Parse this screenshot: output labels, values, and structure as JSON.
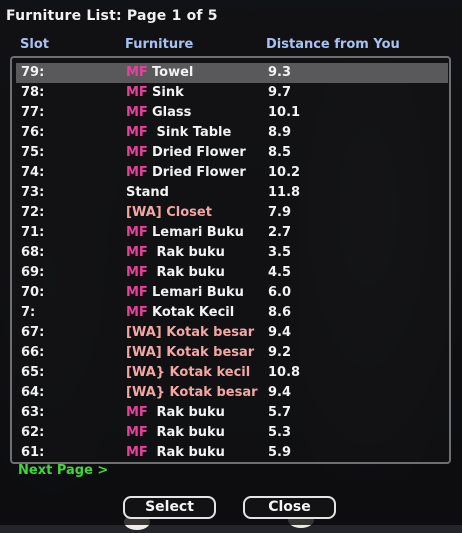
{
  "dialog": {
    "title": "Furniture List: Page 1 of 5",
    "columns": {
      "slot": "Slot",
      "furniture": "Furniture",
      "distance": "Distance from You"
    },
    "rows": [
      {
        "slot": "79:",
        "tag": "MF",
        "name": "Towel",
        "distance": "9.3",
        "selected": true
      },
      {
        "slot": "78:",
        "tag": "MF",
        "name": "Sink",
        "distance": "9.7"
      },
      {
        "slot": "77:",
        "tag": "MF",
        "name": "Glass",
        "distance": "10.1"
      },
      {
        "slot": "76:",
        "tag": "MF",
        "name": " Sink Table",
        "distance": "8.9"
      },
      {
        "slot": "75:",
        "tag": "MF",
        "name": "Dried Flower",
        "distance": "8.5"
      },
      {
        "slot": "74:",
        "tag": "MF",
        "name": "Dried Flower",
        "distance": "10.2"
      },
      {
        "slot": "73:",
        "tag": "",
        "name": "Stand",
        "distance": "11.8"
      },
      {
        "slot": "72:",
        "tag": "",
        "name": "[WA] Closet",
        "distance": "7.9",
        "wa": true
      },
      {
        "slot": "71:",
        "tag": "MF",
        "name": "Lemari Buku",
        "distance": "2.7"
      },
      {
        "slot": "68:",
        "tag": "MF",
        "name": " Rak buku",
        "distance": "3.5"
      },
      {
        "slot": "69:",
        "tag": "MF",
        "name": " Rak buku",
        "distance": "4.5"
      },
      {
        "slot": "70:",
        "tag": "MF",
        "name": "Lemari Buku",
        "distance": "6.0"
      },
      {
        "slot": "7:",
        "tag": "MF",
        "name": "Kotak Kecil",
        "distance": "8.6"
      },
      {
        "slot": "67:",
        "tag": "",
        "name": "[WA] Kotak besar",
        "distance": "9.4",
        "wa": true
      },
      {
        "slot": "66:",
        "tag": "",
        "name": "[WA] Kotak besar",
        "distance": "9.2",
        "wa": true
      },
      {
        "slot": "65:",
        "tag": "",
        "name": "[WA} Kotak kecil",
        "distance": "10.8",
        "wa": true
      },
      {
        "slot": "64:",
        "tag": "",
        "name": "[WA} Kotak besar",
        "distance": "9.4",
        "wa": true
      },
      {
        "slot": "63:",
        "tag": "MF",
        "name": " Rak buku",
        "distance": "5.7"
      },
      {
        "slot": "62:",
        "tag": "MF",
        "name": " Rak buku",
        "distance": "5.3"
      },
      {
        "slot": "61:",
        "tag": "MF",
        "name": " Rak buku",
        "distance": "5.9"
      }
    ],
    "next_page": "Next Page >",
    "buttons": {
      "select": "Select",
      "close": "Close"
    }
  },
  "colors": {
    "header": "#a9c1f2",
    "mf_tag": "#ec3e9c",
    "wa_text": "#f3a6a4",
    "next_page": "#3ed838",
    "selected_row": "#59595c"
  }
}
